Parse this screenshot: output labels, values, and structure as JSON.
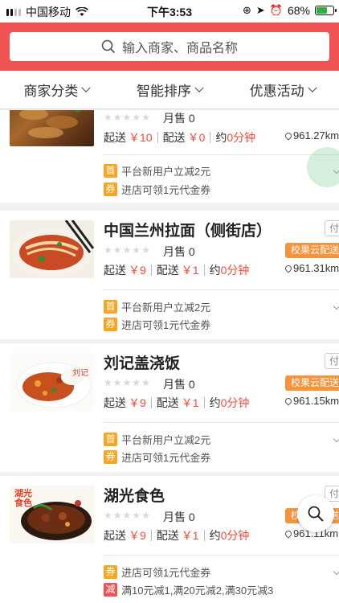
{
  "status_bar": {
    "carrier": "中国移动",
    "time": "下午3:53",
    "battery": "68%",
    "battery_level": 0.68
  },
  "search": {
    "placeholder": "输入商家、商品名称"
  },
  "filters": [
    {
      "label": "商家分类"
    },
    {
      "label": "智能排序"
    },
    {
      "label": "优惠活动"
    }
  ],
  "stores": [
    {
      "name": "",
      "monthly_sales": "月售 0",
      "min_order_label": "起送",
      "min_order": "￥10",
      "delivery_label": "配送",
      "delivery_fee": "￥0",
      "time_label": "约",
      "time": "0分钟",
      "distance": "961.27km",
      "promos": [
        {
          "badge": "首",
          "text": "平台新用户立减2元"
        },
        {
          "badge": "券",
          "text": "进店可领1元代金券"
        }
      ]
    },
    {
      "name": "中国兰州拉面（侧街店）",
      "pay_tag": "付",
      "campus_tag": "校果云配送",
      "monthly_sales": "月售 0",
      "min_order_label": "起送",
      "min_order": "￥9",
      "delivery_label": "配送",
      "delivery_fee": "￥1",
      "time_label": "约",
      "time": "0分钟",
      "distance": "961.31km",
      "promos": [
        {
          "badge": "首",
          "text": "平台新用户立减2元"
        },
        {
          "badge": "券",
          "text": "进店可领1元代金券"
        }
      ]
    },
    {
      "name": "刘记盖浇饭",
      "image_text": "刘记",
      "pay_tag": "付",
      "campus_tag": "校果云配送",
      "monthly_sales": "月售 0",
      "min_order_label": "起送",
      "min_order": "￥9",
      "delivery_label": "配送",
      "delivery_fee": "￥1",
      "time_label": "约",
      "time": "0分钟",
      "distance": "961.15km",
      "promos": [
        {
          "badge": "首",
          "text": "平台新用户立减2元"
        },
        {
          "badge": "券",
          "text": "进店可领1元代金券"
        }
      ]
    },
    {
      "name": "湖光食色",
      "image_text": "湖光食色",
      "pay_tag": "付",
      "campus_tag": "校果云配送",
      "monthly_sales": "月售 0",
      "min_order_label": "起送",
      "min_order": "￥9",
      "delivery_label": "配送",
      "delivery_fee": "￥1",
      "time_label": "约",
      "time": "0分钟",
      "distance": "961.11km",
      "promos": [
        {
          "badge": "券",
          "text": "进店可领1元代金券"
        },
        {
          "badge": "减",
          "text": "满10元减1,满20元减2,满30元减3"
        }
      ]
    }
  ],
  "colors": {
    "brand_red": "#f05353",
    "price_red": "#f04b3b",
    "badge_orange": "#f5a623",
    "campus_orange": "#f7933a"
  }
}
